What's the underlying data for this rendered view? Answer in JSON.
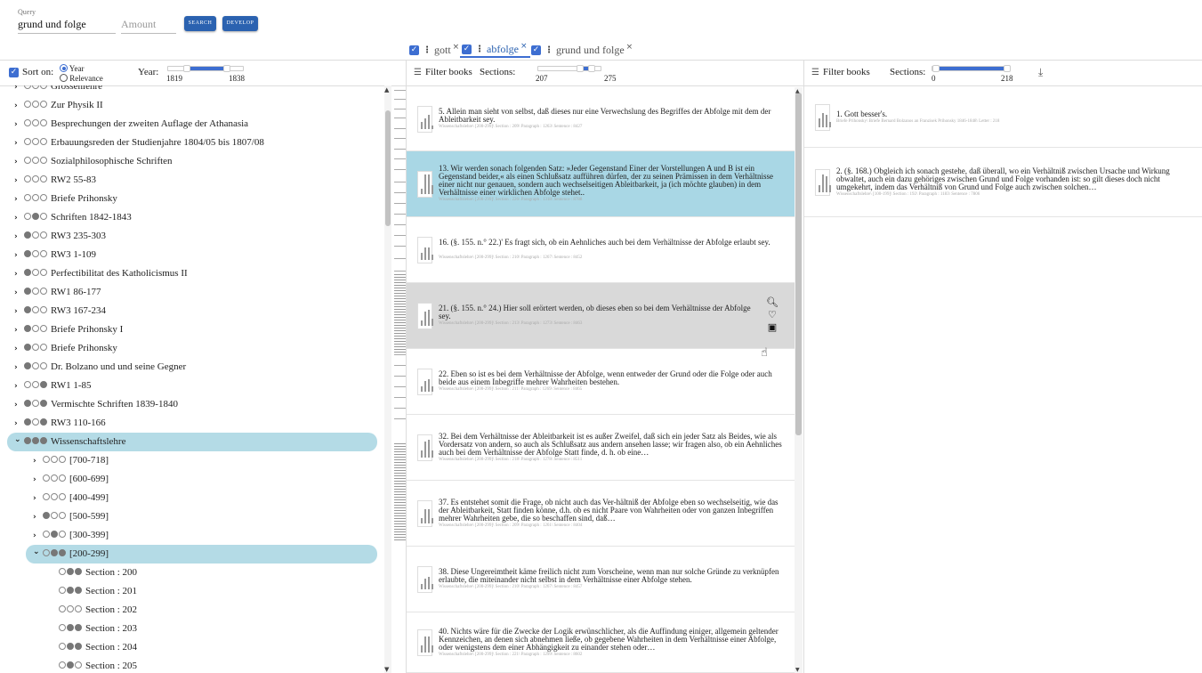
{
  "query": {
    "label": "Query",
    "value": "grund und folge",
    "amount_placeholder": "Amount"
  },
  "buttons": {
    "search": "SEARCH",
    "develop": "DEVELOP"
  },
  "tabs": [
    {
      "label": "gott",
      "checked": true
    },
    {
      "label": "abfolge",
      "checked": true,
      "active": true
    },
    {
      "label": "grund und folge",
      "checked": true
    }
  ],
  "left_controls": {
    "sort_on": "Sort on:",
    "radio_year": "Year",
    "radio_relevance": "Relevance",
    "year_label": "Year:",
    "year_min": "1819",
    "year_max": "1838"
  },
  "tree": [
    {
      "label": "Grossenlehre",
      "dots": [
        0,
        0,
        0
      ]
    },
    {
      "label": "Zur Physik II",
      "dots": [
        0,
        0,
        0
      ]
    },
    {
      "label": "Besprechungen der zweiten Auflage der Athanasia",
      "dots": [
        0,
        0,
        0
      ]
    },
    {
      "label": "Erbauungsreden der Studienjahre 1804/05 bis 1807/08",
      "dots": [
        0,
        0,
        0
      ]
    },
    {
      "label": "Sozialphilosophische Schriften",
      "dots": [
        0,
        0,
        0
      ]
    },
    {
      "label": "RW2 55-83",
      "dots": [
        0,
        0,
        0
      ]
    },
    {
      "label": "Briefe Prihonsky",
      "dots": [
        0,
        0,
        0
      ]
    },
    {
      "label": "Schriften 1842-1843",
      "dots": [
        0,
        1,
        0
      ]
    },
    {
      "label": "RW3 235-303",
      "dots": [
        1,
        0,
        0
      ]
    },
    {
      "label": "RW3 1-109",
      "dots": [
        1,
        0,
        0
      ]
    },
    {
      "label": "Perfectibilitat des Katholicismus II",
      "dots": [
        1,
        0,
        0
      ]
    },
    {
      "label": "RW1 86-177",
      "dots": [
        1,
        0,
        0
      ]
    },
    {
      "label": "RW3 167-234",
      "dots": [
        1,
        0,
        0
      ]
    },
    {
      "label": "Briefe Prihonsky I",
      "dots": [
        1,
        0,
        0
      ]
    },
    {
      "label": "Briefe Prihonsky",
      "dots": [
        1,
        0,
        0
      ]
    },
    {
      "label": "Dr. Bolzano und und seine Gegner",
      "dots": [
        1,
        0,
        0
      ]
    },
    {
      "label": "RW1 1-85",
      "dots": [
        0,
        0,
        1
      ]
    },
    {
      "label": "Vermischte Schriften 1839-1840",
      "dots": [
        1,
        0,
        1
      ]
    },
    {
      "label": "RW3 110-166",
      "dots": [
        1,
        0,
        1
      ]
    },
    {
      "label": "Wissenschaftslehre",
      "dots": [
        1,
        1,
        1
      ],
      "selected": true,
      "expanded": true
    },
    {
      "label": "[700-718]",
      "dots": [
        0,
        0,
        0
      ],
      "level": 1
    },
    {
      "label": "[600-699]",
      "dots": [
        0,
        0,
        0
      ],
      "level": 1
    },
    {
      "label": "[400-499]",
      "dots": [
        0,
        0,
        0
      ],
      "level": 1
    },
    {
      "label": "[500-599]",
      "dots": [
        1,
        0,
        0
      ],
      "level": 1
    },
    {
      "label": "[300-399]",
      "dots": [
        0,
        1,
        0
      ],
      "level": 1
    },
    {
      "label": "[200-299]",
      "dots": [
        0,
        1,
        1
      ],
      "level": 1,
      "selected": true,
      "expanded": true
    },
    {
      "label": "Section : 200",
      "dots": [
        0,
        1,
        1
      ],
      "level": 2
    },
    {
      "label": "Section : 201",
      "dots": [
        0,
        1,
        1
      ],
      "level": 2
    },
    {
      "label": "Section : 202",
      "dots": [
        0,
        0,
        0
      ],
      "level": 2
    },
    {
      "label": "Section : 203",
      "dots": [
        0,
        1,
        1
      ],
      "level": 2
    },
    {
      "label": "Section : 204",
      "dots": [
        0,
        1,
        1
      ],
      "level": 2
    },
    {
      "label": "Section : 205",
      "dots": [
        0,
        1,
        0
      ],
      "level": 2
    }
  ],
  "mid_controls": {
    "filter": "Filter books",
    "sections": "Sections:",
    "min": "207",
    "max": "275"
  },
  "mid_cards": [
    {
      "text": "5. Allein man sieht von selbst, daß dieses nur eine Verwechslung des Begriffes der Abfolge mit dem der Ableitbarkeit sey.",
      "meta": "Wissenschaftslehre\\ [200-299]\\ Section : 209\\ Paragraph : 1263\\ Sentence : 8427"
    },
    {
      "text": "13. Wir werden sonach folgenden Satz: »Jeder Gegenstand Einer der Vorstellungen A und B ist ein Gegenstand beider,« als einen Schlußsatz aufführen dürfen, der zu seinen Prämissen in dem Verhältnisse einer nicht nur genauen, sondern auch wechselseitigen Ableitbarkeit, ja (ich möchte glauben) in dem Verhältnisse einer wirklichen Abfolge stehet..",
      "meta": "Wissenschaftslehre\\ [200-299]\\ Section : 226\\ Paragraph : 1318\\ Sentence : 8788"
    },
    {
      "text": "16. (§. 155. n.° 22.)' Es fragt sich, ob ein Aehnliches auch bei dem Verhältnisse der Abfolge erlaubt sey.",
      "meta": "Wissenschaftslehre\\ [200-299]\\ Section : 210\\ Paragraph : 1267\\ Sentence : 8452"
    },
    {
      "text": "21. (§. 155. n.° 24.) Hier soll erörtert werden, ob dieses eben so bei dem Verhältnisse der Abfolge sey.",
      "meta": "Wissenschaftslehre\\ [200-299]\\ Section : 213\\ Paragraph : 1273\\ Sentence : 8463"
    },
    {
      "text": "22. Eben so ist es bei dem Verhältnisse der Abfolge, wenn entweder der Grund oder die Folge oder auch beide aus einem Inbegriffe mehrer Wahrheiten bestehen.",
      "meta": "Wissenschaftslehre\\ [200-299]\\ Section : 211\\ Paragraph : 1269\\ Sentence : 8465"
    },
    {
      "text": "32. Bei dem Verhältnisse der Ableitbarkeit ist es außer Zweifel, daß sich ein jeder Satz als Beides, wie als Vordersatz von andern, so auch als Schlußsatz aus andern ansehen lasse; wir fragen also, ob ein Aehnliches auch bei dem Verhältnisse der Abfolge Statt finde, d. h. ob eine…",
      "meta": "Wissenschaftslehre\\ [200-299]\\ Section : 218\\ Paragraph : 1278\\ Sentence : 8511"
    },
    {
      "text": "37. Es entstehet somit die Frage, ob nicht auch das Ver-hältniß der Abfolge eben so wechselseitig, wie das der Ableitbarkeit, Statt finden könne, d.h. ob es nicht Paare von Wahrheiten oder von ganzen Inbegriffen mehrer Wahrheiten gebe, die so beschaffen sind, daß…",
      "meta": "Wissenschaftslehre\\ [200-299]\\ Section : 209\\ Paragraph : 1261\\ Sentence : 8404"
    },
    {
      "text": "38. Diese Ungereimtheit käme freilich nicht zum Vorscheine, wenn man nur solche Gründe zu verknüpfen erlaubte, die miteinander nicht selbst in dem Verhältnisse einer Abfolge stehen.",
      "meta": "Wissenschaftslehre\\ [200-299]\\ Section : 210\\ Paragraph : 1267\\ Sentence : 8457"
    },
    {
      "text": "40. Nichts wäre für die Zwecke der Logik erwünschlicher, als die Auffindung einiger, allgemein geltender Kennzeichen, an denen sich abnehmen ließe, ob gegebene Wahrheiten in dem Verhältnisse einer Abfolge, oder wenigstens dem einer Abhängigkeit zu einander stehen oder…",
      "meta": "Wissenschaftslehre\\ [200-299]\\ Section : 221\\ Paragraph : 1299\\ Sentence : 8602"
    }
  ],
  "card_actions": {
    "search_icon": "search-icon",
    "heart_icon": "heart-icon",
    "doc_icon": "document-search-icon"
  },
  "right_controls": {
    "filter": "Filter books",
    "sections": "Sections:",
    "min": "0",
    "max": "218"
  },
  "right_cards": [
    {
      "text": "1. Gott besser's.",
      "meta": "Briefe Prihonsky\\ Briefe Bernard Bolzanos an Franzisek Prihonsky 1846-1848\\ Letter : 218"
    },
    {
      "text": "2. (§. 168.) Obgleich ich sonach gestehe, daß überall, wo ein Verhältniß zwischen Ursache und Wirkung obwaltet, auch ein dazu gehöriges zwischen Grund und Folge vorhanden ist: so gilt dieses doch nicht umgekehrt, indem das Verhältniß von Grund und Folge auch zwischen solchen…",
      "meta": "Wissenschaftslehre\\ [100-199]\\ Section : 192\\ Paragraph : 1183\\ Sentence : 7806"
    }
  ],
  "colors": {
    "accent": "#3d6ed1",
    "selected_bg": "#b4dbe6",
    "highlight_card": "#a9d7e5",
    "hover_card": "#d9d9d9"
  }
}
